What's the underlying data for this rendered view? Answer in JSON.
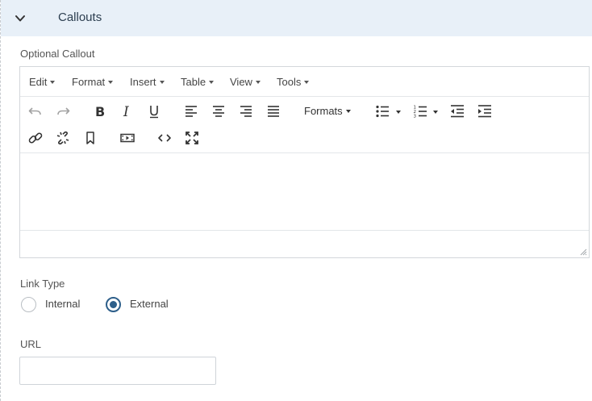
{
  "section": {
    "title": "Callouts",
    "toggle_icon": "chevron-down-icon"
  },
  "callout_field": {
    "label": "Optional Callout"
  },
  "editor": {
    "menus": [
      "Edit",
      "Format",
      "Insert",
      "Table",
      "View",
      "Tools"
    ],
    "toolbar": {
      "formats_label": "Formats",
      "row1_icons": [
        "undo-icon",
        "redo-icon",
        "bold-icon",
        "italic-icon",
        "underline-icon",
        "align-left-icon",
        "align-center-icon",
        "align-right-icon",
        "align-justify-icon",
        "formats-dropdown",
        "bullet-list-icon",
        "numbered-list-icon",
        "outdent-icon",
        "indent-icon"
      ],
      "row2_icons": [
        "link-icon",
        "unlink-icon",
        "bookmark-icon",
        "media-icon",
        "code-icon",
        "fullscreen-icon"
      ]
    },
    "content": ""
  },
  "link_type": {
    "label": "Link Type",
    "options": [
      {
        "label": "Internal",
        "checked": false
      },
      {
        "label": "External",
        "checked": true
      }
    ]
  },
  "url": {
    "label": "URL",
    "value": "",
    "placeholder": ""
  },
  "colors": {
    "header_bg": "#e8f0f8",
    "radio_accent": "#2e5f8a",
    "border": "#d3d7db"
  }
}
